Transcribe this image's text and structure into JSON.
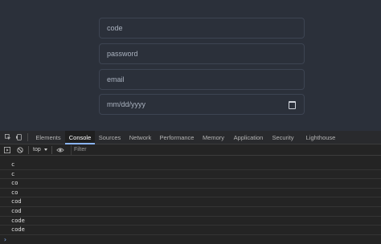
{
  "form": {
    "code_placeholder": "code",
    "password_placeholder": "password",
    "email_placeholder": "email",
    "date_placeholder": "mm/dd/yyyy"
  },
  "devtools": {
    "tabs": [
      "Elements",
      "Console",
      "Sources",
      "Network",
      "Performance",
      "Memory",
      "Application",
      "Security",
      "Lighthouse"
    ],
    "active_tab": "Console",
    "context": "top",
    "filter_placeholder": "Filter",
    "console_lines": [
      "c",
      "c",
      "co",
      "co",
      "cod",
      "cod",
      "code",
      "code"
    ],
    "prompt_symbol": "›"
  },
  "colors": {
    "accent": "#8ab4f8",
    "page_bg": "#2b303a"
  }
}
